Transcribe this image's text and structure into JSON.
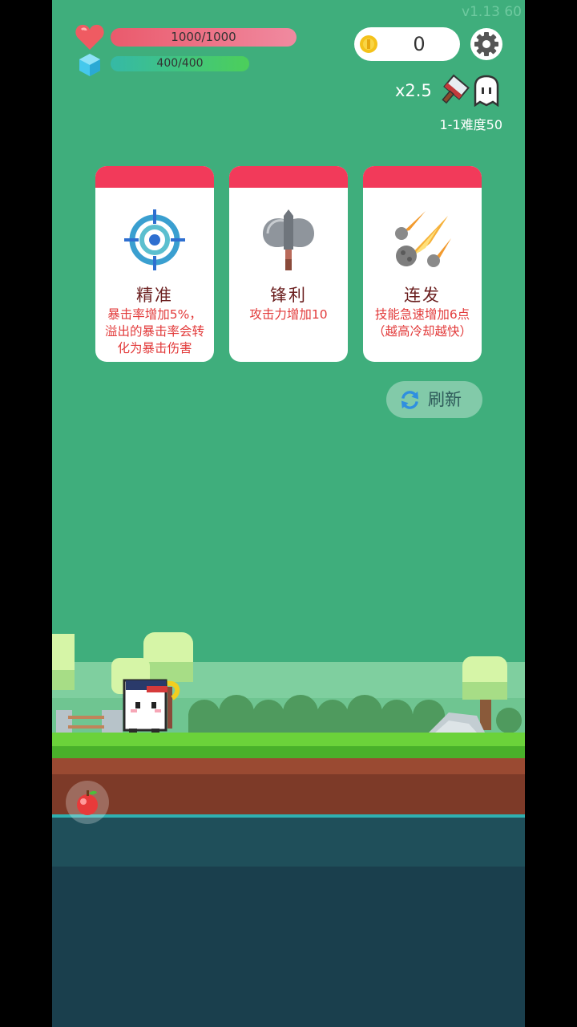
{
  "version": "v1.13   60",
  "hud": {
    "hp_text": "1000/1000",
    "mp_text": "400/400",
    "hp_fraction": 1.0,
    "mp_fraction": 1.0,
    "coins": "0",
    "multiplier": "x2.5",
    "stage": "1-1难度50"
  },
  "cards": [
    {
      "icon": "crosshair-icon",
      "title": "精准",
      "description": "暴击率增加5%，溢出的暴击率会转化为暴击伤害"
    },
    {
      "icon": "battle-axe-icon",
      "title": "锋利",
      "description": "攻击力增加10"
    },
    {
      "icon": "meteor-icon",
      "title": "连发",
      "description": "技能急速增加6点（越高冷却越快）"
    }
  ],
  "refresh": {
    "label": "刷新"
  },
  "colors": {
    "background": "#3fae7c",
    "card_header": "#f23a5a",
    "card_text": "#e23a3a",
    "hp_bar": "#ea5a6c",
    "mp_bar": "#4ccf5a"
  }
}
